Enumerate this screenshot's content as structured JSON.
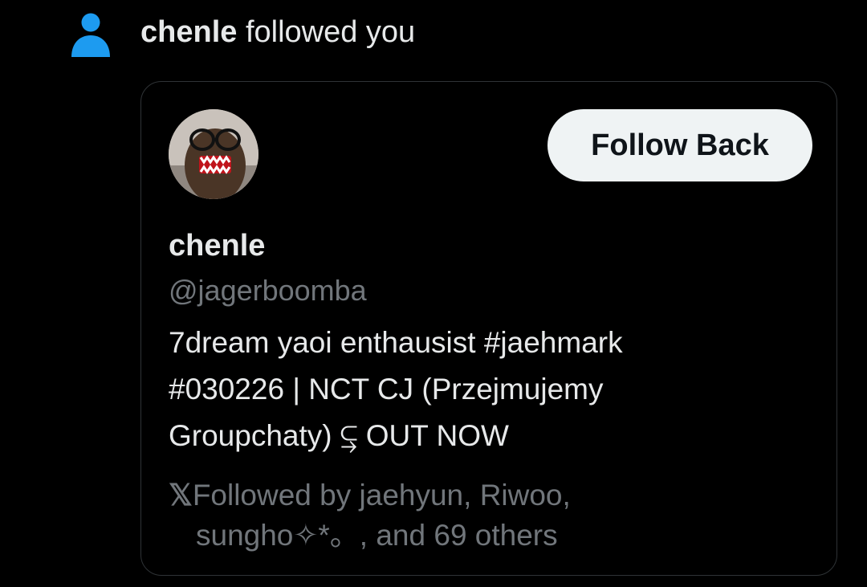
{
  "notification": {
    "icon": "person-icon",
    "actor_name": "chenle",
    "action_text": " followed you"
  },
  "profile_card": {
    "avatar_icon": "avatar-photo",
    "follow_button_label": "Follow Back",
    "display_name": "chenle",
    "handle": "@jagerboomba",
    "bio_lines": [
      "7dream yaoi enthausist #jaehmark",
      "#030226 | NCT CJ (Przejmujemy",
      "Groupchaty) ⥹ OUT NOW"
    ],
    "followed_by": {
      "logo": "𝕏",
      "line1": "Followed by jaehyun, Riwoo,",
      "line2": "sungho✧*。, and 69 others"
    }
  },
  "colors": {
    "background": "#000000",
    "primary_text": "#e7e9ea",
    "secondary_text": "#71767b",
    "accent_blue": "#1d9bf0",
    "button_bg": "#eff3f4",
    "card_border": "#2f3336"
  }
}
